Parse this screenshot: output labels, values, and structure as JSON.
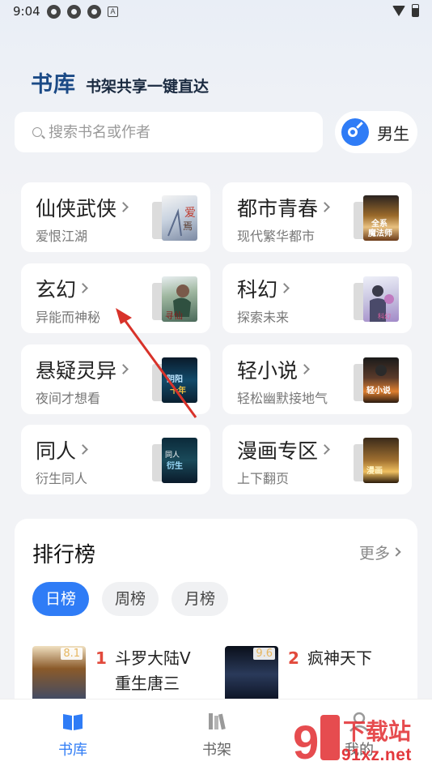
{
  "status_bar": {
    "time": "9:04",
    "notif_letter": "A"
  },
  "header": {
    "title": "书库",
    "subtitle": "书架共享一键直达"
  },
  "search": {
    "placeholder": "搜索书名或作者"
  },
  "gender_toggle": {
    "label": "男生",
    "icon": "male-icon"
  },
  "categories": [
    {
      "name": "仙侠武侠",
      "desc": "爱恨江湖"
    },
    {
      "name": "都市青春",
      "desc": "现代繁华都市"
    },
    {
      "name": "玄幻",
      "desc": "异能而神秘"
    },
    {
      "name": "科幻",
      "desc": "探索未来"
    },
    {
      "name": "悬疑灵异",
      "desc": "夜间才想看"
    },
    {
      "name": "轻小说",
      "desc": "轻松幽默接地气"
    },
    {
      "name": "同人",
      "desc": "衍生同人"
    },
    {
      "name": "漫画专区",
      "desc": "上下翻页"
    }
  ],
  "ranking": {
    "title": "排行榜",
    "more": "更多",
    "tabs": [
      "日榜",
      "周榜",
      "月榜"
    ],
    "active_tab": "日榜",
    "books": [
      {
        "rank": "1",
        "title_line1": "斗罗大陆V",
        "title_line2": "重生唐三",
        "score": "8.1"
      },
      {
        "rank": "2",
        "title_line1": "疯神天下",
        "title_line2": "",
        "score": "9.6"
      }
    ]
  },
  "bottom_nav": [
    {
      "label": "书库",
      "icon": "book-open-icon",
      "active": true
    },
    {
      "label": "书架",
      "icon": "bookshelf-icon",
      "active": false
    },
    {
      "label": "我的",
      "icon": "profile-icon",
      "active": false
    }
  ],
  "watermark": {
    "text": "91xz.net",
    "brand": "9 下载站"
  },
  "colors": {
    "accent": "#2f7cf6",
    "header_title": "#1b4a86",
    "rank_number": "#e24a3c",
    "annotation_arrow": "#d8322a"
  }
}
